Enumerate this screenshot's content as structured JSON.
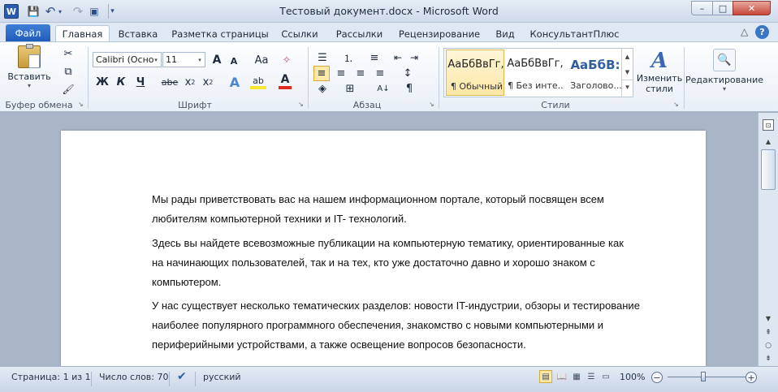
{
  "window": {
    "title": "Тестовый документ.docx - Microsoft Word",
    "word_logo": "W",
    "minimize": "–",
    "maximize": "□",
    "close": "✕"
  },
  "quick_access": {
    "save_icon": "💾",
    "undo_icon": "↶",
    "undo_dropdown": "▾",
    "redo_icon": "↷",
    "print_preview_icon": "▣",
    "customize_icon": "▾"
  },
  "tabs": {
    "file": "Файл",
    "items": [
      "Главная",
      "Вставка",
      "Разметка страницы",
      "Ссылки",
      "Рассылки",
      "Рецензирование",
      "Вид",
      "КонсультантПлюс"
    ],
    "collapse_icon": "△",
    "help_icon": "?"
  },
  "ribbon": {
    "clipboard": {
      "label": "Буфер обмена",
      "paste_label": "Вставить",
      "paste_arrow": "▾",
      "cut_icon": "✂",
      "copy_icon": "⧉",
      "format_painter_icon": "🖌",
      "launcher": "↘"
    },
    "font": {
      "label": "Шрифт",
      "font_name": "Calibri (Осно",
      "font_size": "11",
      "grow_font": "A",
      "shrink_font": "A",
      "change_case": "Aa",
      "clear_format": "✧",
      "bold": "Ж",
      "italic": "К",
      "underline": "Ч",
      "strikethrough": "abe",
      "subscript": "x",
      "subscript_index": "2",
      "superscript": "x",
      "superscript_index": "2",
      "text_effects": "A",
      "highlight": "ab",
      "font_color": "A",
      "launcher": "↘",
      "dropdown_arrow": "▾"
    },
    "paragraph": {
      "label": "Абзац",
      "bullets_icon": "☰",
      "numbering_icon": "⒈",
      "multilevel_icon": "≡",
      "decrease_indent_icon": "⇤",
      "increase_indent_icon": "⇥",
      "sort_icon": "A↓",
      "show_marks_icon": "¶",
      "align_left_icon": "≡",
      "align_center_icon": "≡",
      "align_right_icon": "≡",
      "justify_icon": "≡",
      "line_spacing_icon": "↕",
      "shading_icon": "◈",
      "borders_icon": "⊞",
      "launcher": "↘"
    },
    "styles": {
      "label": "Стили",
      "items": [
        {
          "sample": "АаБбВвГг,",
          "name": "¶ Обычный"
        },
        {
          "sample": "АаБбВвГг,",
          "name": "¶ Без инте..."
        },
        {
          "sample": "АаБбВ:",
          "name": "Заголово..."
        }
      ],
      "heading_color": "#2f5fa0",
      "change_styles_label": "Изменить стили",
      "change_styles_icon": "A",
      "launcher": "↘",
      "scroll_up": "▲",
      "scroll_down": "▼",
      "more": "▾"
    },
    "editing": {
      "label": "Редактирование",
      "icon": "🔍",
      "arrow": "▾"
    }
  },
  "document": {
    "paragraphs": [
      [
        "Мы рады приветствовать вас на нашем информационном портале, который посвящен всем",
        "любителям компьютерной техники и IT- технологий."
      ],
      [
        "Здесь вы найдете всевозможные публикации на компьютерную тематику, ориентированные как",
        "на начинающих пользователей, так и на тех, кто уже достаточно давно и хорошо знаком с",
        "компьютером."
      ],
      [
        "У нас существует несколько тематических разделов: новости IT-индустрии, обзоры и тестирование",
        "наиболее популярного программного обеспечения, знакомство с новыми компьютерными и",
        "периферийными устройствами, а также освещение вопросов безопасности."
      ]
    ]
  },
  "scrollbar": {
    "ruler_toggle": "⊡",
    "up": "▲",
    "down": "▼",
    "prev_page": "⇞",
    "select_browse": "○",
    "next_page": "⇟"
  },
  "status_bar": {
    "page": "Страница: 1 из 1",
    "words": "Число слов: 70",
    "proofing_icon": "✔",
    "language": "русский",
    "view_icons": [
      "▤",
      "📖",
      "▦",
      "☰",
      "▭"
    ],
    "zoom": "100%",
    "zoom_out": "−",
    "zoom_in": "+"
  }
}
